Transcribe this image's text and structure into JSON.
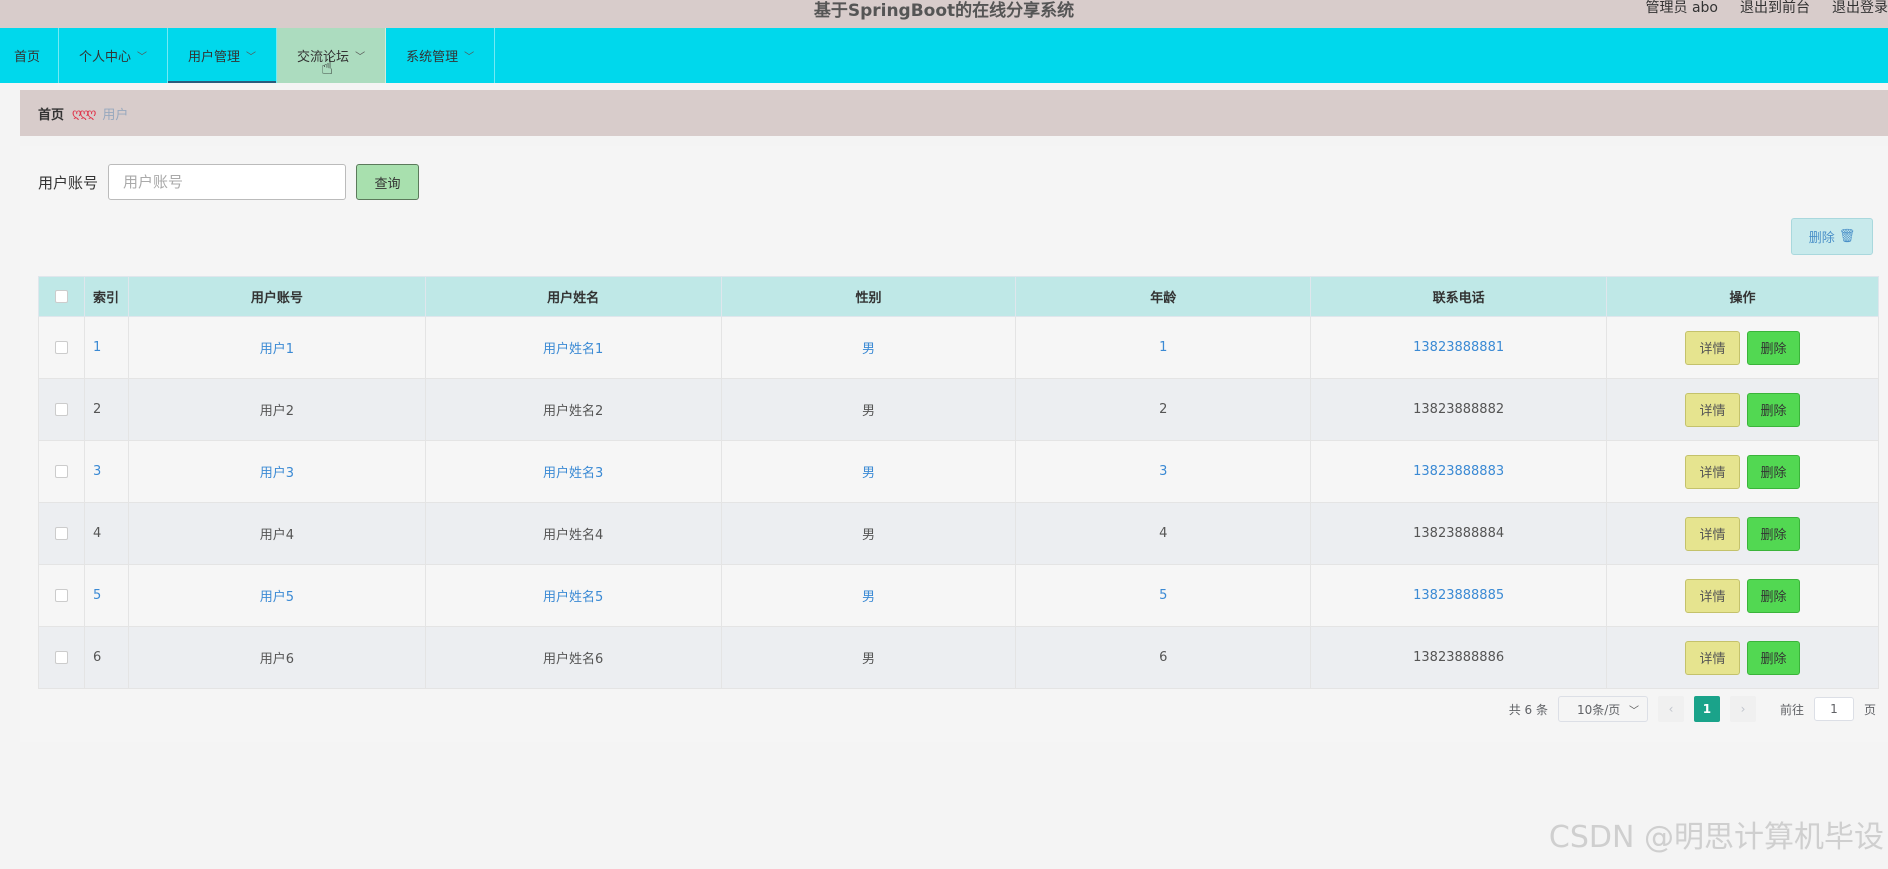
{
  "header": {
    "title": "基于SpringBoot的在线分享系统",
    "links": [
      "管理员 abo",
      "退出到前台",
      "退出登录"
    ]
  },
  "nav": {
    "items": [
      {
        "label": "首页",
        "dropdown": false
      },
      {
        "label": "个人中心",
        "dropdown": true
      },
      {
        "label": "用户管理",
        "dropdown": true
      },
      {
        "label": "交流论坛",
        "dropdown": true
      },
      {
        "label": "系统管理",
        "dropdown": true
      }
    ]
  },
  "breadcrumb": {
    "home": "首页",
    "separator": "ღღღ",
    "current": "用户"
  },
  "search": {
    "label": "用户账号",
    "placeholder": "用户账号",
    "query_label": "查询"
  },
  "batch_delete_label": "删除",
  "table": {
    "columns": [
      "索引",
      "用户账号",
      "用户姓名",
      "性别",
      "年龄",
      "联系电话",
      "操作"
    ],
    "rows": [
      {
        "index": "1",
        "account": "用户1",
        "name": "用户姓名1",
        "gender": "男",
        "age": "1",
        "phone": "13823888881"
      },
      {
        "index": "2",
        "account": "用户2",
        "name": "用户姓名2",
        "gender": "男",
        "age": "2",
        "phone": "13823888882"
      },
      {
        "index": "3",
        "account": "用户3",
        "name": "用户姓名3",
        "gender": "男",
        "age": "3",
        "phone": "13823888883"
      },
      {
        "index": "4",
        "account": "用户4",
        "name": "用户姓名4",
        "gender": "男",
        "age": "4",
        "phone": "13823888884"
      },
      {
        "index": "5",
        "account": "用户5",
        "name": "用户姓名5",
        "gender": "男",
        "age": "5",
        "phone": "13823888885"
      },
      {
        "index": "6",
        "account": "用户6",
        "name": "用户姓名6",
        "gender": "男",
        "age": "6",
        "phone": "13823888886"
      }
    ],
    "detail_label": "详情",
    "delete_label": "删除"
  },
  "pagination": {
    "total_text": "共 6 条",
    "page_size": "10条/页",
    "current_page": "1",
    "goto_prefix": "前往",
    "goto_value": "1",
    "goto_suffix": "页"
  },
  "watermark": "CSDN @明思计算机毕设",
  "colors": {
    "topbar": "#d8cccb",
    "nav": "#00d8ec",
    "nav_active": "#acdcbf",
    "table_header": "#bfe8e7",
    "detail_button": "#e6e48f",
    "delete_button": "#52d852",
    "pager_active": "#1aa38a"
  }
}
